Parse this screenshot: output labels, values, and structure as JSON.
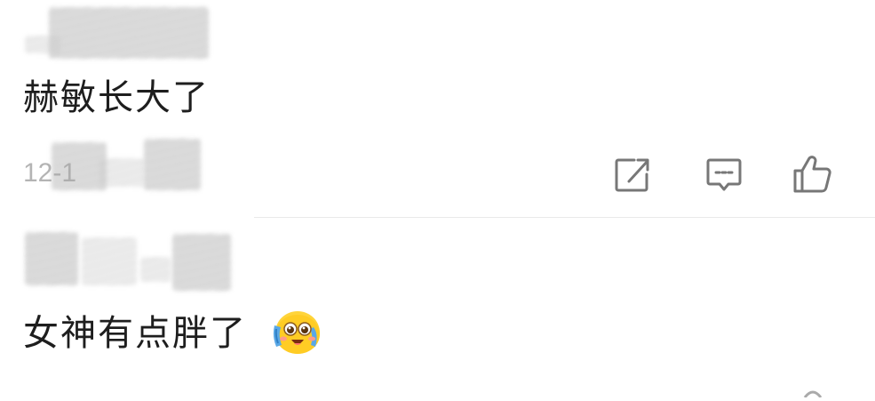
{
  "comments": [
    {
      "text": "赫敏长大了",
      "time": "12-1",
      "actions": {
        "share_icon": "share-icon",
        "reply_icon": "comment-icon",
        "like_icon": "thumbs-up-icon"
      }
    },
    {
      "text": "女神有点胖了",
      "emoji": "blushing-face-emoji"
    }
  ],
  "colors": {
    "text": "#1e1e1e",
    "meta": "#b4b4b4",
    "icon": "#777777",
    "divider": "#e9e9e9"
  }
}
